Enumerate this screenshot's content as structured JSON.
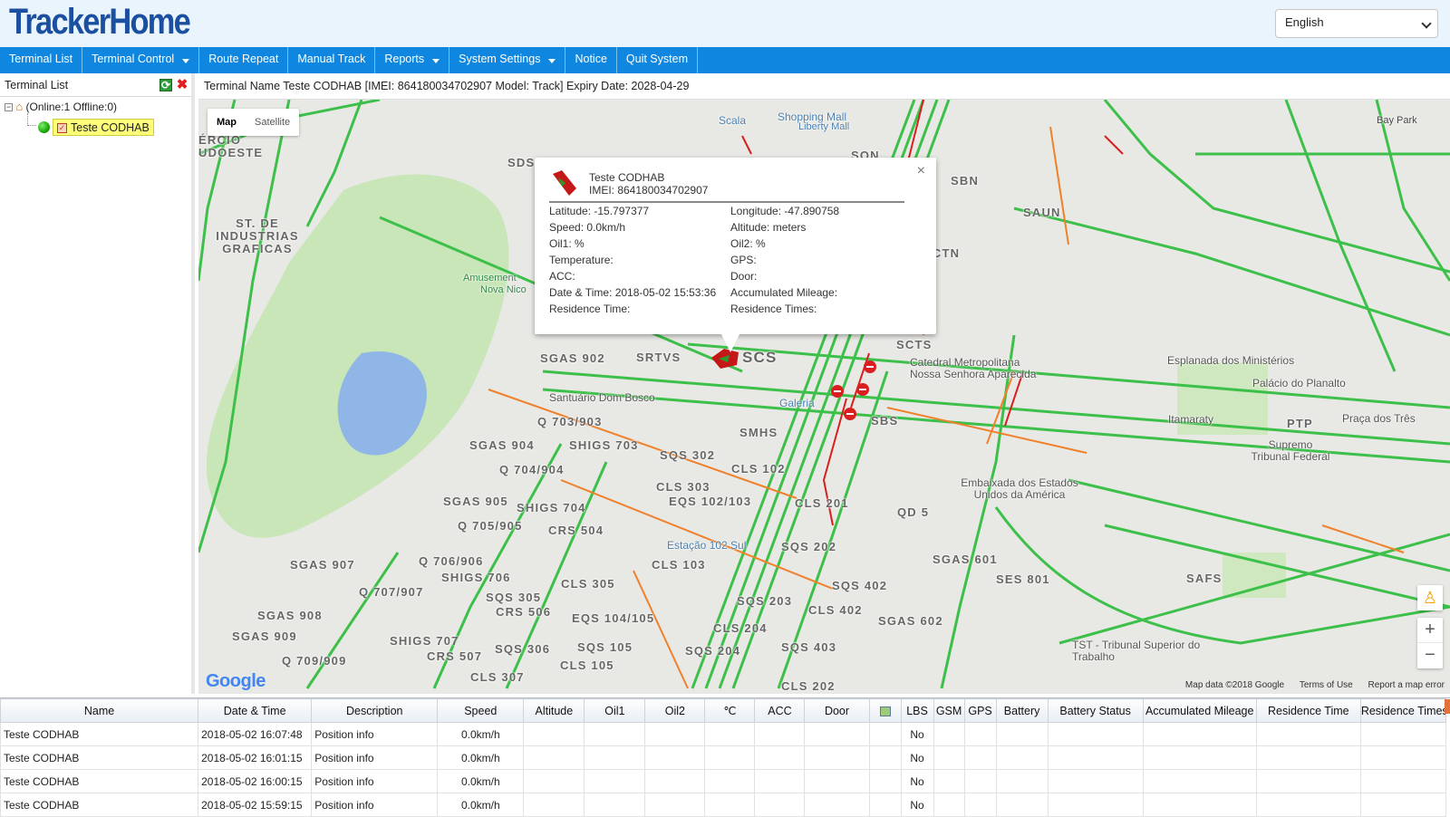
{
  "app": {
    "logo": "TrackerHome"
  },
  "language": {
    "selected": "English"
  },
  "menu": [
    {
      "label": "Terminal List",
      "dropdown": false
    },
    {
      "label": "Terminal Control",
      "dropdown": true
    },
    {
      "label": "Route Repeat",
      "dropdown": false
    },
    {
      "label": "Manual Track",
      "dropdown": false
    },
    {
      "label": "Reports",
      "dropdown": true
    },
    {
      "label": "System Settings",
      "dropdown": true
    },
    {
      "label": "Notice",
      "dropdown": false
    },
    {
      "label": "Quit System",
      "dropdown": false
    }
  ],
  "sidebar": {
    "title": "Terminal List",
    "tree_root": "(Online:1   Offline:0)",
    "tree_item": "Teste CODHAB"
  },
  "infobar": {
    "text": "Terminal Name Teste CODHAB [IMEI: 864180034702907  Model: Track]  Expiry Date: 2028-04-29"
  },
  "map": {
    "type_buttons": [
      "Map",
      "Satellite"
    ],
    "active_type": "Map",
    "labels": [
      "SCS",
      "SCTS",
      "SBS",
      "SMHS",
      "SAUN",
      "SBN",
      "SCTN",
      "SRTVS",
      "SGAS 902",
      "SGAS 904",
      "SGAS 905",
      "SGAS 907",
      "SGAS 908",
      "SGAS 909",
      "Q 703/903",
      "Q 704/904",
      "Q 705/905",
      "Q 706/906",
      "Q 707/907",
      "Q 709/909",
      "SHIGS 703",
      "SHIGS 704",
      "SHIGS 706",
      "SHIGS 707",
      "SQS 302",
      "SQS 305",
      "SQS 306",
      "SQS 105",
      "SQS 202",
      "SQS 203",
      "SQS 204",
      "SQS 402",
      "SQS 403",
      "CLS 102",
      "CLS 103",
      "CLS 105",
      "CLS 201",
      "CLS 202",
      "CLS 204",
      "CLS 303",
      "CLS 305",
      "CLS 307",
      "CLS 402",
      "CRS 504",
      "CRS 506",
      "CRS 507",
      "EQS 102/103",
      "EQS 104/105",
      "QD 5",
      "SGAS 601",
      "SGAS 602",
      "SES 801",
      "SAFS",
      "PTP",
      "ST. DE INDUSTRIAS GRAFICAS",
      "ÉRCIO UDOESTE",
      "SDS",
      "SON",
      "Bay Park"
    ],
    "pois": [
      "Scala",
      "Shopping Mall",
      "Liberty Mall",
      "Santuário Dom Bosco",
      "Galeria",
      "Estação 102 Sul",
      "Catedral Metropolitana Nossa Senhora Aparecida",
      "Esplanada dos Ministérios",
      "Palácio do Planalto",
      "Itamaraty",
      "Praça dos Três",
      "Supremo Tribunal Federal",
      "Embaixada dos Estados Unidos da América",
      "TST - Tribunal Superior do Trabalho",
      "Amusement",
      "Nova Nico"
    ],
    "footer": [
      "Map data ©2018 Google",
      "Terms of Use",
      "Report a map error"
    ],
    "google": "Google",
    "zoom_in": "+",
    "zoom_out": "−"
  },
  "popup": {
    "name": "Teste CODHAB",
    "imei": "IMEI: 864180034702907",
    "fields": [
      "Latitude: -15.797377",
      "Longitude: -47.890758",
      "Speed: 0.0km/h",
      "Altitude: meters",
      "Oil1: %",
      "Oil2: %",
      "Temperature:",
      "GPS:",
      "ACC:",
      "Door:",
      "Date & Time: 2018-05-02 15:53:36",
      "Accumulated Mileage:",
      "Residence Time:",
      "Residence Times:"
    ]
  },
  "table": {
    "headers": [
      "Name",
      "Date & Time",
      "Description",
      "Speed",
      "Altitude",
      "Oil1",
      "Oil2",
      "℃",
      "ACC",
      "Door",
      "",
      "LBS",
      "GSM",
      "GPS",
      "Battery",
      "Battery Status",
      "Accumulated Mileage",
      "Residence Time",
      "Residence Times"
    ],
    "rows": [
      [
        "Teste CODHAB",
        "2018-05-02 16:07:48",
        "Position info",
        "0.0km/h",
        "",
        "",
        "",
        "",
        "",
        "",
        "",
        "No",
        "",
        "",
        "",
        "",
        "",
        "",
        ""
      ],
      [
        "Teste CODHAB",
        "2018-05-02 16:01:15",
        "Position info",
        "0.0km/h",
        "",
        "",
        "",
        "",
        "",
        "",
        "",
        "No",
        "",
        "",
        "",
        "",
        "",
        "",
        ""
      ],
      [
        "Teste CODHAB",
        "2018-05-02 16:00:15",
        "Position info",
        "0.0km/h",
        "",
        "",
        "",
        "",
        "",
        "",
        "",
        "No",
        "",
        "",
        "",
        "",
        "",
        "",
        ""
      ],
      [
        "Teste CODHAB",
        "2018-05-02 15:59:15",
        "Position info",
        "0.0km/h",
        "",
        "",
        "",
        "",
        "",
        "",
        "",
        "No",
        "",
        "",
        "",
        "",
        "",
        "",
        ""
      ]
    ]
  },
  "colors": {
    "menu_bg": "#0f87e0",
    "logo": "#1b4fa0",
    "map_bg": "#e8e8e4",
    "park": "#c8e6b8",
    "road_green": "#3cc04a",
    "road_orange": "#f0802a",
    "road_red": "#d82020"
  }
}
